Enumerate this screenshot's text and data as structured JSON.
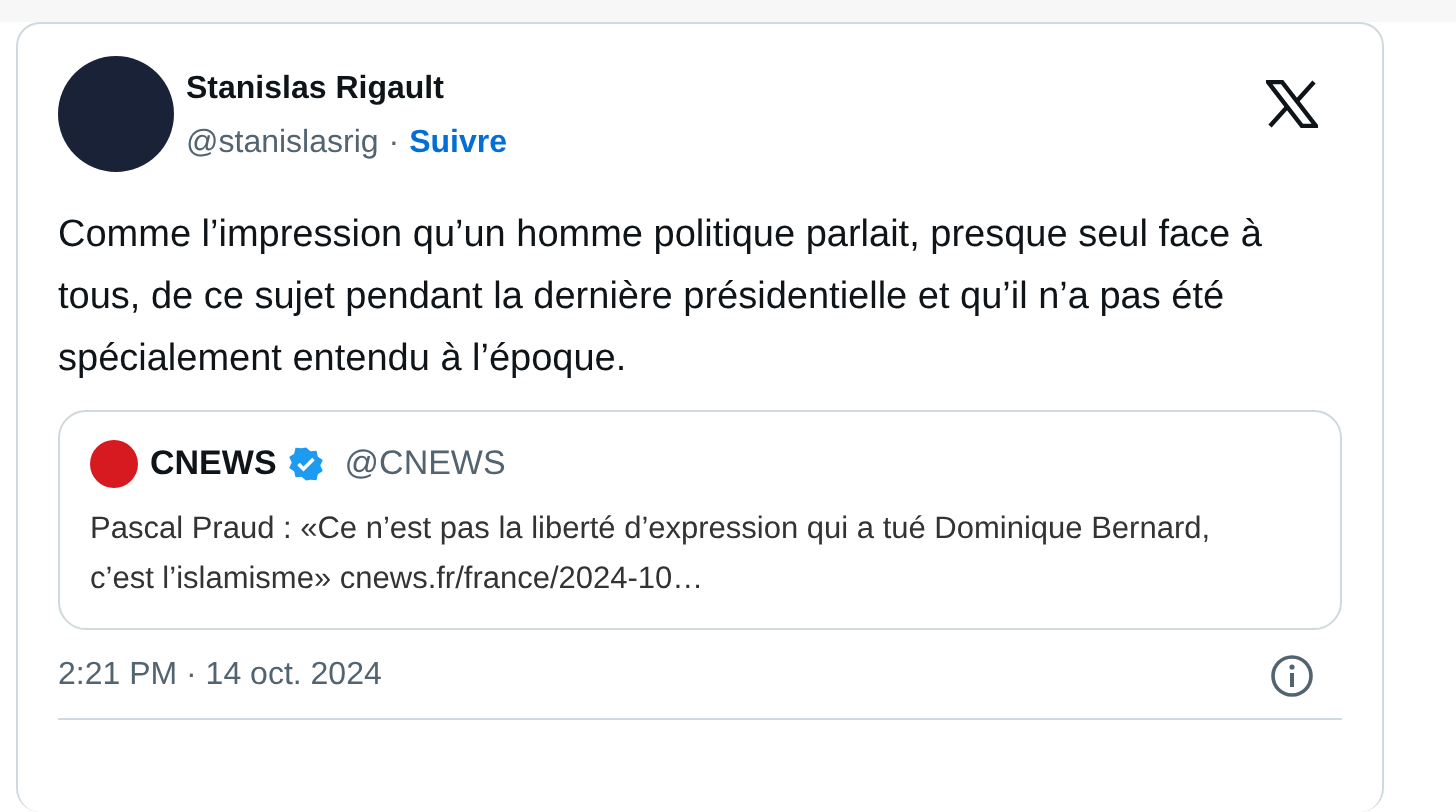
{
  "tweet": {
    "author": {
      "name": "Stanislas Rigault",
      "handle": "@stanislasrig",
      "separator": "·",
      "follow": "Suivre"
    },
    "text": "Comme l’impression qu’un homme politique parlait, presque seul face à tous, de ce sujet pendant la dernière présidentielle et qu’il n’a pas été spécialement entendu à l’époque.",
    "quote": {
      "name": "CNEWS",
      "verified": true,
      "handle": "@CNEWS",
      "text": "Pascal Praud : «Ce n’est pas la liberté d’expression qui a tué Dominique Bernard, c’est l’islamisme» cnews.fr/france/2024-10…"
    },
    "timestamp": "2:21 PM · 14 oct. 2024"
  }
}
